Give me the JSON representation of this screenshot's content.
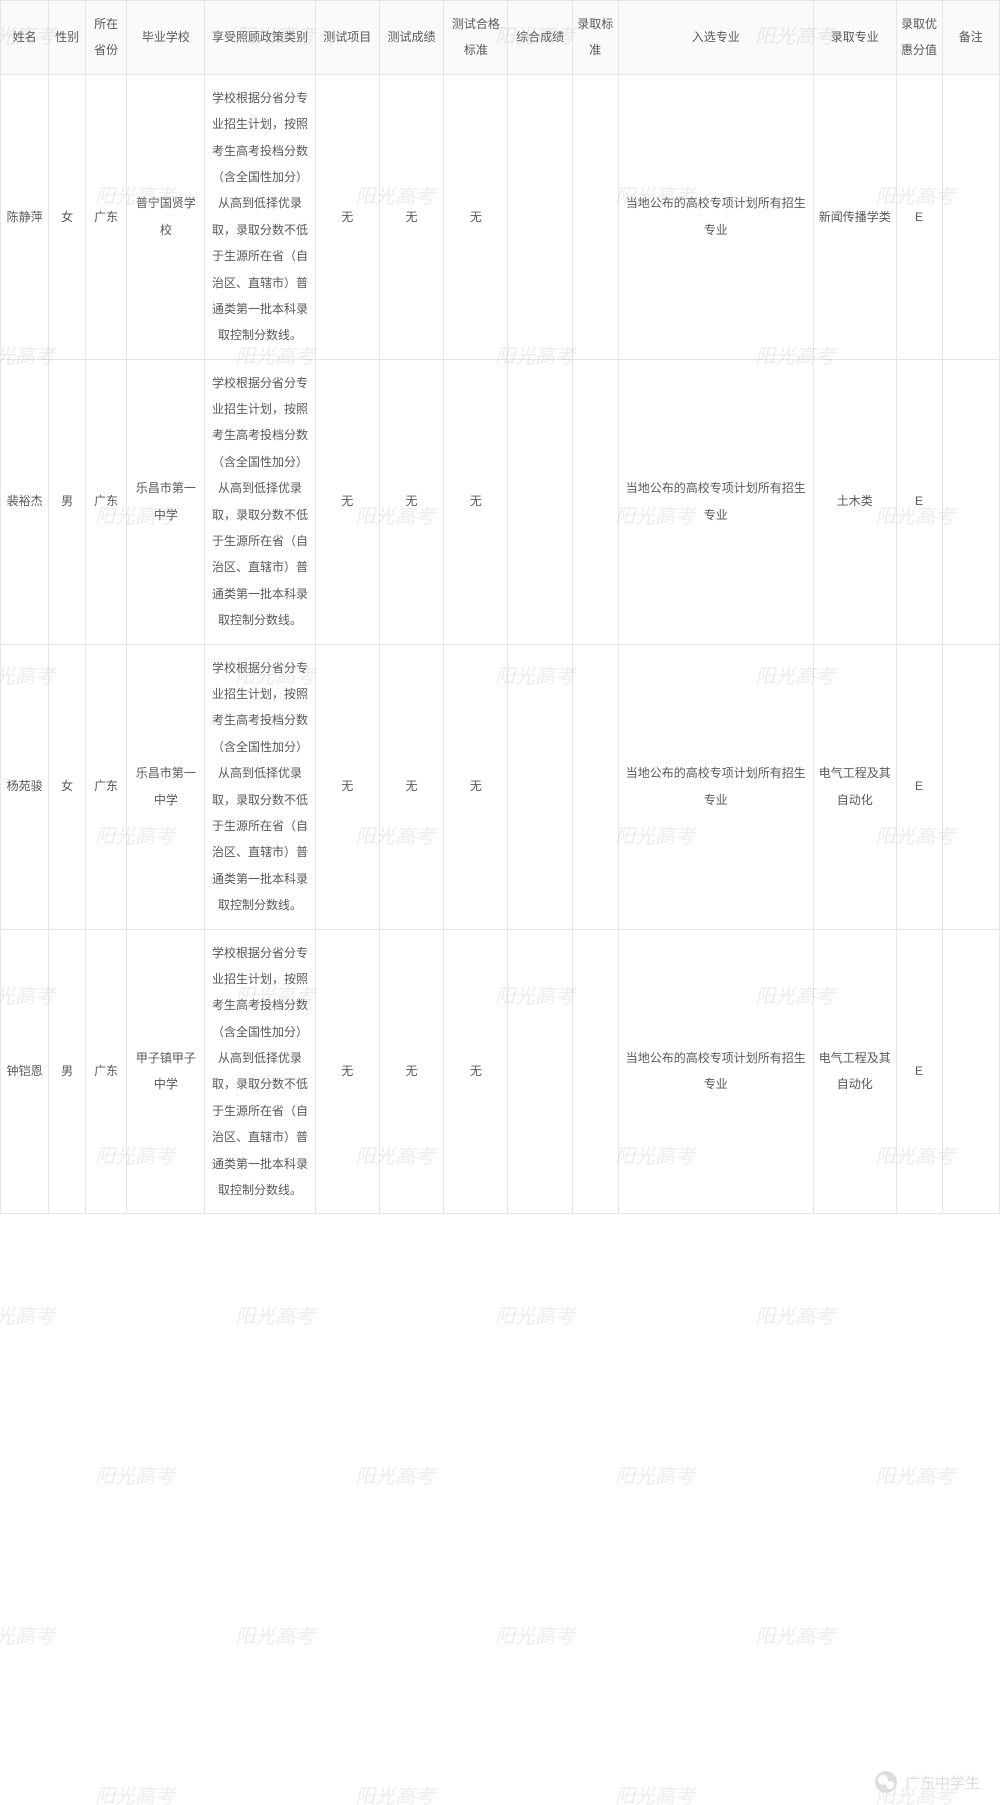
{
  "watermark_text": "阳光高考",
  "footer_source": "广东中学生",
  "headers": {
    "name": "姓名",
    "gender": "性别",
    "province": "所在省份",
    "school": "毕业学校",
    "policy": "享受照顾政策类别",
    "test_item": "测试项目",
    "test_score": "测试成绩",
    "pass_std": "测试合格标准",
    "comp_score": "综合成绩",
    "adm_std": "录取标准",
    "selected_major": "入选专业",
    "admitted_major": "录取专业",
    "bonus": "录取优惠分值",
    "remark": "备注"
  },
  "policy_text": "学校根据分省分专业招生计划，按照考生高考投档分数（含全国性加分）从高到低择优录取，录取分数不低于生源所在省（自治区、直辖市）普通类第一批本科录取控制分数线。",
  "selected_major_text": "当地公布的高校专项计划所有招生专业",
  "rows": [
    {
      "name": "陈静萍",
      "gender": "女",
      "province": "广东",
      "school": "普宁国贤学校",
      "test_item": "无",
      "test_score": "无",
      "pass_std": "无",
      "comp_score": "",
      "adm_std": "",
      "admitted_major": "新闻传播学类",
      "bonus": "E",
      "remark": ""
    },
    {
      "name": "裴裕杰",
      "gender": "男",
      "province": "广东",
      "school": "乐昌市第一中学",
      "test_item": "无",
      "test_score": "无",
      "pass_std": "无",
      "comp_score": "",
      "adm_std": "",
      "admitted_major": "土木类",
      "bonus": "E",
      "remark": ""
    },
    {
      "name": "杨苑骏",
      "gender": "女",
      "province": "广东",
      "school": "乐昌市第一中学",
      "test_item": "无",
      "test_score": "无",
      "pass_std": "无",
      "comp_score": "",
      "adm_std": "",
      "admitted_major": "电气工程及其自动化",
      "bonus": "E",
      "remark": ""
    },
    {
      "name": "钟铠恩",
      "gender": "男",
      "province": "广东",
      "school": "甲子镇甲子中学",
      "test_item": "无",
      "test_score": "无",
      "pass_std": "无",
      "comp_score": "",
      "adm_std": "",
      "admitted_major": "电气工程及其自动化",
      "bonus": "E",
      "remark": ""
    }
  ]
}
